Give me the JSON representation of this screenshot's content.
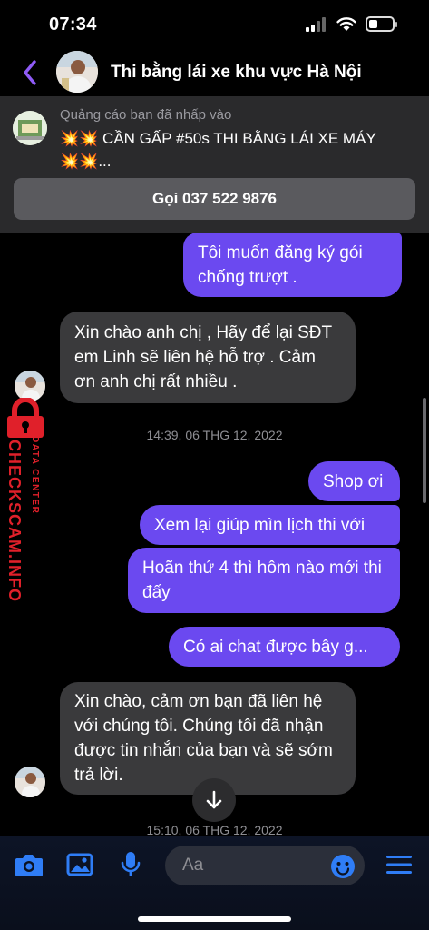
{
  "status_bar": {
    "time": "07:34"
  },
  "header": {
    "title": "Thi bằng lái xe khu vực Hà Nội"
  },
  "ad": {
    "label": "Quảng cáo bạn đã nhấp vào",
    "text": "💥💥  CẦN GẤP #50s THI BẰNG LÁI XE MÁY   💥💥...",
    "call_button": "Gọi 037 522 9876"
  },
  "messages": [
    {
      "text": "Tôi muốn đăng ký gói chống trượt ."
    },
    {
      "text": "Xin chào anh chị , Hãy để lại SĐT em Linh sẽ liên hệ hỗ trợ . Cảm ơn anh chị rất nhiều ."
    },
    {
      "text": "Shop ơi"
    },
    {
      "text": "Xem lại giúp mìn lịch thi với"
    },
    {
      "text": "Hoãn thứ 4 thì hôm nào mới thi đấy"
    },
    {
      "text": "Có ai chat được bây g..."
    },
    {
      "text": "Xin chào, cảm ơn bạn đã liên hệ với chúng tôi. Chúng tôi đã nhận được tin nhắn của bạn và sẽ sớm trả lời."
    }
  ],
  "timestamps": [
    "14:39, 06 THG 12, 2022",
    "15:10, 06 THG 12, 2022"
  ],
  "watermark": {
    "main": "CHECKSCAM.INFO",
    "sub": "DATA CENTER"
  },
  "composer": {
    "placeholder": "Aa"
  },
  "colors": {
    "accent": "#6b49f0",
    "incoming": "#3a3a3c",
    "icon_blue": "#2f7df6",
    "back_purple": "#8f5bf6",
    "watermark_red": "#e0202a"
  },
  "icons": [
    "back-chevron-icon",
    "camera-icon",
    "gallery-icon",
    "microphone-icon",
    "emoji-icon",
    "menu-icon",
    "arrow-down-icon",
    "lock-icon"
  ]
}
